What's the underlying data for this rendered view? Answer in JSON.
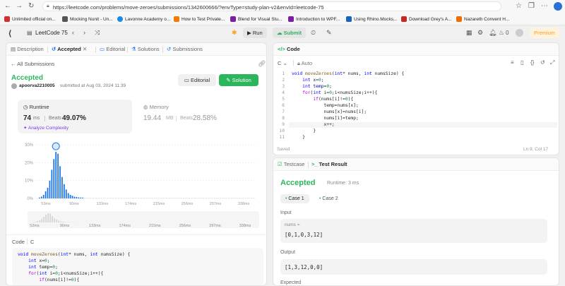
{
  "browser": {
    "url": "https://leetcode.com/problems/move-zeroes/submissions/1342600666/?envType=study-plan-v2&envId=leetcode-75",
    "bookmarks": [
      {
        "label": "Unlimited official on...",
        "color": "#d32f2f"
      },
      {
        "label": "Mocking Nunit - Un...",
        "color": "#555555"
      },
      {
        "label": "Lavonne Academy o...",
        "color": "#1e88e5"
      },
      {
        "label": "How to Test Private...",
        "color": "#f57c00"
      },
      {
        "label": "Blend for Visual Stu...",
        "color": "#7b1fa2"
      },
      {
        "label": "Introduction to WPF...",
        "color": "#7b1fa2"
      },
      {
        "label": "Using Rhino.Mocks...",
        "color": "#1565c0"
      },
      {
        "label": "Download Grey's A...",
        "color": "#c62828"
      },
      {
        "label": "Nazareth Convent H...",
        "color": "#ef6c00"
      }
    ]
  },
  "topbar": {
    "problem_list": "LeetCode 75",
    "run_label": "Run",
    "submit_label": "Submit",
    "streak": "0",
    "premium_label": "Premium"
  },
  "left_tabs": [
    {
      "label": "Description"
    },
    {
      "label": "Accepted"
    },
    {
      "label": "Editorial"
    },
    {
      "label": "Solutions"
    },
    {
      "label": "Submissions"
    }
  ],
  "submission": {
    "back_label": "All Submissions",
    "status": "Accepted",
    "user": "apoorva2210005",
    "submitted_text": "submitted at Aug 03, 2024 11:39",
    "editorial_button": "Editorial",
    "solution_button": "Solution",
    "runtime_label": "Runtime",
    "runtime_value": "74",
    "runtime_unit": "ms",
    "runtime_beats_label": "Beats",
    "runtime_beats": "49.07%",
    "analyze_label": "Analyze Complexity",
    "memory_label": "Memory",
    "memory_value": "19.44",
    "memory_unit": "MB",
    "memory_beats_label": "Beats",
    "memory_beats": "28.58%"
  },
  "chart_data": {
    "type": "bar",
    "yticks": [
      "30%",
      "20%",
      "10%",
      "0%"
    ],
    "ylim": [
      0,
      30
    ],
    "xticks": [
      "53ms",
      "90ms",
      "133ms",
      "174ms",
      "215ms",
      "256ms",
      "297ms",
      "338ms"
    ],
    "values": [
      0.5,
      1,
      2,
      4,
      6,
      10,
      16,
      22,
      26,
      25,
      18,
      12,
      8,
      5,
      3,
      2,
      1.5,
      1,
      0.8,
      0.6,
      0.5,
      0.5,
      0.4,
      0.4,
      0.3,
      0.3,
      0.3,
      0.3,
      0.3,
      0.3,
      0.3,
      0.3,
      0.3,
      0.3,
      0.3,
      0.3,
      0.3,
      0.3,
      0.3,
      0.3,
      0.3,
      0.3,
      0.3,
      0.3,
      0.3,
      0.3,
      0.3,
      0.3,
      0.3,
      0.3,
      0.3,
      0.3,
      0.3,
      0.3,
      0.3,
      0.3,
      0.3,
      0.3,
      0.3,
      0.3,
      0.3,
      0.3,
      0.3,
      0.3,
      0.3,
      0.3,
      0.3,
      0.3,
      0.3,
      0.3,
      0.3,
      0.3,
      0.3,
      0.3,
      0.3,
      0.3,
      0.3,
      0.3,
      0.3,
      0.3,
      0.3,
      0.3,
      0.3,
      0.3,
      0.3,
      0.3,
      0.3,
      0.3,
      0.3,
      0.3,
      0.3,
      0.3,
      0.3,
      0.3,
      0.3,
      0.3,
      0.3,
      0.3,
      0.3,
      0.3,
      0.3,
      0.3,
      0.3,
      0.3,
      0.3
    ],
    "highlight_index": 8,
    "bar_color": "#1a73e8",
    "bar_color_faint": "#c9dcf6"
  },
  "mini_chart": {
    "xticks": [
      "52ms",
      "90ms",
      "133ms",
      "174ms",
      "215ms",
      "256ms",
      "297ms",
      "338ms"
    ]
  },
  "code_section": {
    "label": "Code",
    "lang": "C",
    "lines": [
      "void moveZeroes(int* nums, int numsSize) {",
      "    int x=0;",
      "    int temp=0;",
      "    for(int i=0;i<numsSize;i++){",
      "        if(nums[i]!=0){"
    ]
  },
  "editor": {
    "title": "Code",
    "lang": "C",
    "mode": "Auto",
    "saved": "Saved",
    "cursor": "Ln 9, Col 17",
    "lines": [
      "void moveZeroes(int* nums, int numsSize) {",
      "    int x=0;",
      "    int temp=0;",
      "    for(int i=0;i<numsSize;i++){",
      "        if(nums[i]!=0){",
      "            temp=nums[x];",
      "            nums[x]=nums[i];",
      "            nums[i]=temp;",
      "            x++;",
      "        }",
      "    }"
    ],
    "line_numbers": [
      "1",
      "2",
      "3",
      "4",
      "5",
      "6",
      "7",
      "8",
      "9",
      "10",
      "11"
    ]
  },
  "test": {
    "tab_testcase": "Testcase",
    "tab_result": "Test Result",
    "status": "Accepted",
    "runtime": "Runtime: 3 ms",
    "case1": "Case 1",
    "case2": "Case 2",
    "input_label": "Input",
    "input_name": "nums =",
    "input_value": "[0,1,0,3,12]",
    "output_label": "Output",
    "output_value": "[1,3,12,0,0]",
    "expected_label": "Expected"
  }
}
